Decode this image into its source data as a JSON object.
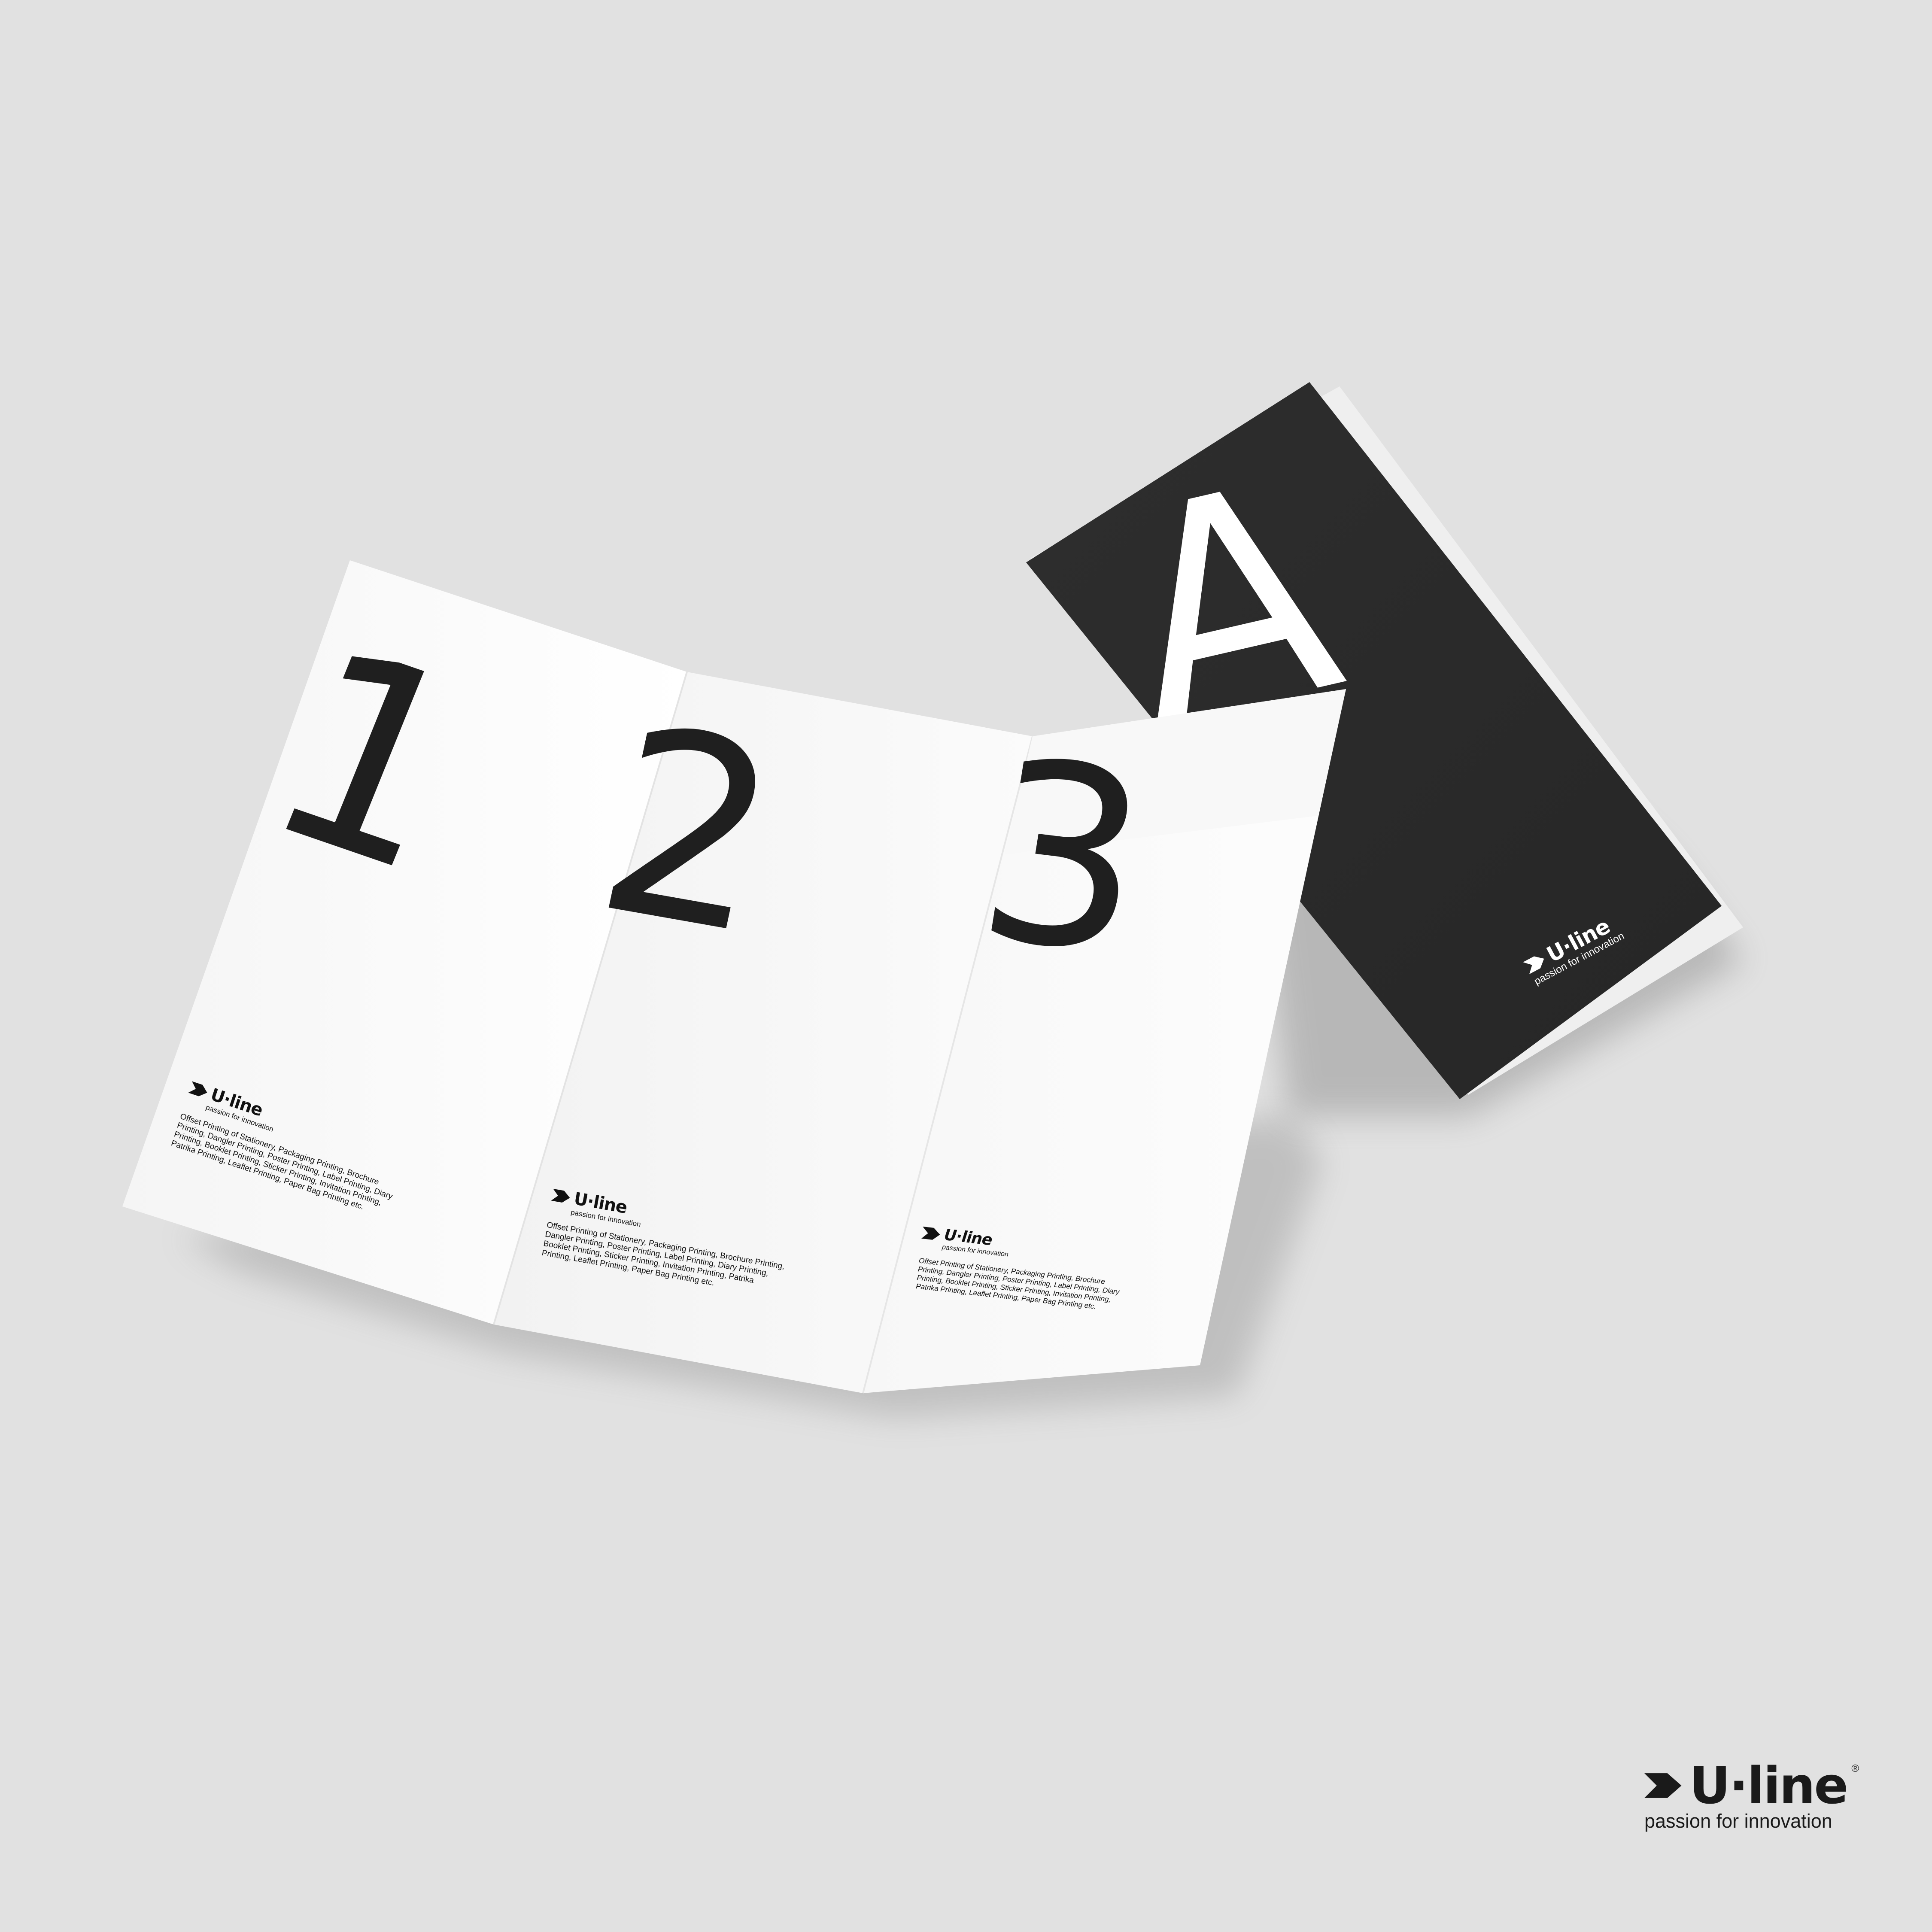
{
  "colors": {
    "background": "#e1e1e1",
    "paper": "#f8f8f8",
    "cover": "#2b2b2b",
    "ink": "#1f1f1f"
  },
  "panels": [
    {
      "numeral": "1"
    },
    {
      "numeral": "2"
    },
    {
      "numeral": "3"
    }
  ],
  "cover": {
    "letter": "A"
  },
  "logo": {
    "brand": "U·line",
    "registered": "®",
    "tagline": "passion for innovation",
    "icon": "arrow-chevron-icon"
  },
  "panel_text": "Offset Printing of Stationery, Packaging Printing, Brochure Printing, Dangler Printing, Poster Printing, Label Printing, Diary Printing, Booklet Printing, Sticker Printing, Invitation Printing, Patrika Printing, Leaflet Printing, Paper Bag Printing etc."
}
